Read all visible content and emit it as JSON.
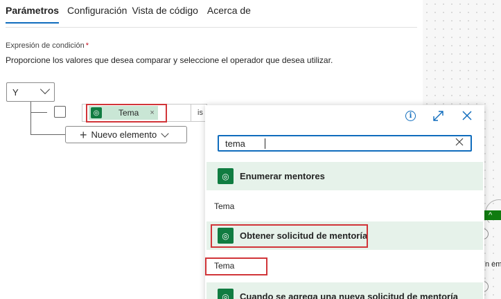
{
  "tabs": [
    {
      "label": "Parámetros",
      "active": true
    },
    {
      "label": "Configuración",
      "active": false
    },
    {
      "label": "Vista de código",
      "active": false
    },
    {
      "label": "Acerca de",
      "active": false
    }
  ],
  "condition": {
    "label": "Expresión de condición",
    "required_marker": "*",
    "description": "Proporcione los valores que desea comparar y seleccione el operador que desea utilizar.",
    "logic_operator": "Y",
    "token": {
      "label": "Tema",
      "remove": "×",
      "icon": "dataverse-icon"
    },
    "operator_partial": "is",
    "new_item_button": "Nuevo elemento"
  },
  "flyout": {
    "search_value": "tema",
    "groups": [
      {
        "label": "Enumerar mentores",
        "items": [
          "Tema"
        ]
      },
      {
        "label": "Obtener solicitud de mentoría",
        "items": [
          "Tema"
        ]
      },
      {
        "label": "Cuando se agrega una nueva solicitud de mentoría",
        "items": []
      }
    ]
  },
  "canvas": {
    "partial_text": "n emai"
  },
  "colors": {
    "accent": "#0f6cbd",
    "highlight": "#d13438",
    "dataverse_green": "#107c41",
    "group_bg": "#e6f2ea"
  }
}
